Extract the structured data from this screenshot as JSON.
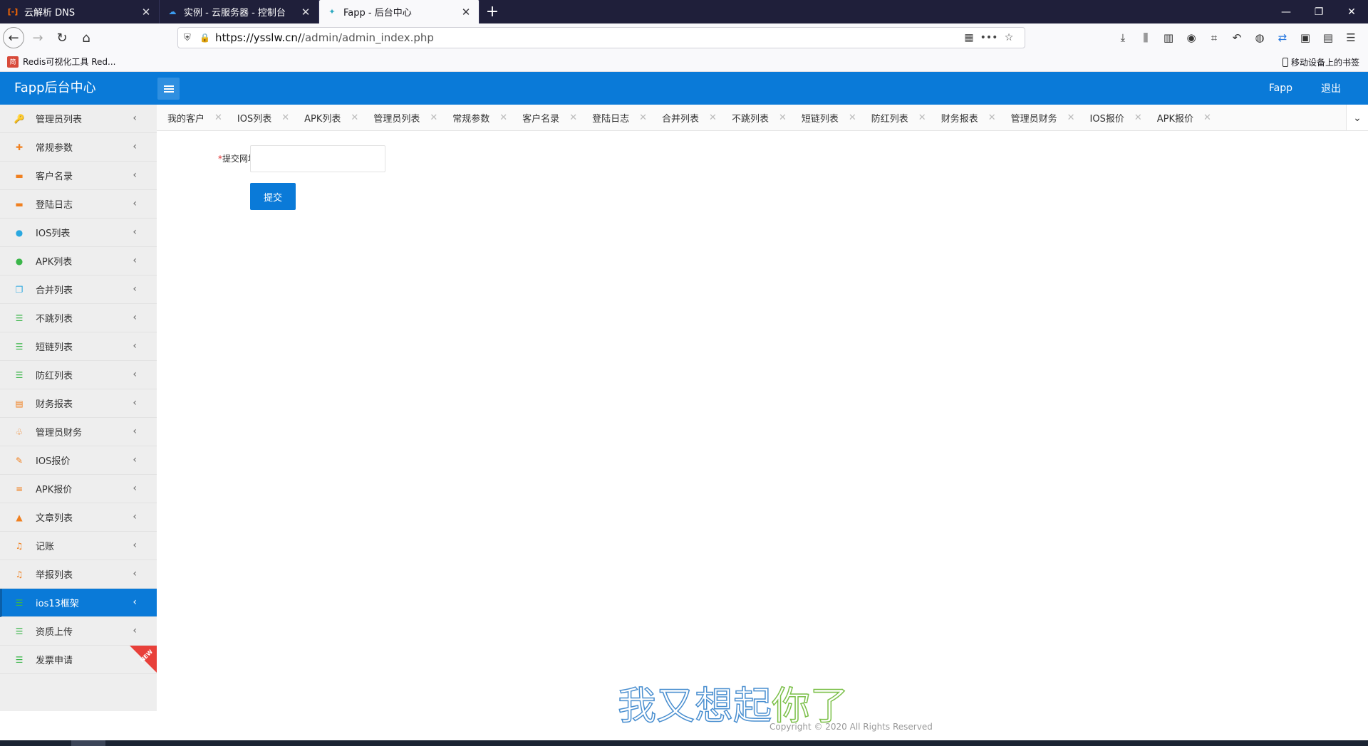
{
  "browser": {
    "tabs": [
      {
        "title": "云解析 DNS",
        "favicon": "aliyun-icon",
        "favicon_glyph": "[-]",
        "active": false
      },
      {
        "title": "实例 - 云服务器 - 控制台",
        "favicon": "cloud-icon",
        "favicon_glyph": "☁",
        "active": false
      },
      {
        "title": "Fapp - 后台中心",
        "favicon": "fapp-icon",
        "favicon_glyph": "✦",
        "active": true
      }
    ],
    "new_tab": "+",
    "url_host": "https://ysslw.cn/",
    "url_path": "/admin/admin_index.php",
    "bookmark": "Redis可视化工具 Red...",
    "bookmark_right": "移动设备上的书签"
  },
  "app": {
    "logo": "Fapp后台中心",
    "header_right": [
      "Fapp",
      "退出"
    ],
    "accent_color": "#0a7ad8"
  },
  "sidebar": {
    "items": [
      {
        "label": "管理员列表",
        "icon": "key-icon",
        "glyph": "🔑",
        "color": "#e8a040"
      },
      {
        "label": "常规参数",
        "icon": "plus-icon",
        "glyph": "✚",
        "color": "#f08020"
      },
      {
        "label": "客户名录",
        "icon": "briefcase-icon",
        "glyph": "▬",
        "color": "#f08020"
      },
      {
        "label": "登陆日志",
        "icon": "briefcase-icon",
        "glyph": "▬",
        "color": "#f08020"
      },
      {
        "label": "IOS列表",
        "icon": "apple-icon",
        "glyph": "●",
        "color": "#2aa8e0"
      },
      {
        "label": "APK列表",
        "icon": "android-icon",
        "glyph": "●",
        "color": "#3bb64a"
      },
      {
        "label": "合并列表",
        "icon": "copy-icon",
        "glyph": "❐",
        "color": "#2aa8e0"
      },
      {
        "label": "不跳列表",
        "icon": "rss-icon",
        "glyph": "☰",
        "color": "#3bb64a"
      },
      {
        "label": "短链列表",
        "icon": "rss-icon",
        "glyph": "☰",
        "color": "#3bb64a"
      },
      {
        "label": "防红列表",
        "icon": "rss-icon",
        "glyph": "☰",
        "color": "#3bb64a"
      },
      {
        "label": "财务报表",
        "icon": "files-icon",
        "glyph": "▤",
        "color": "#f08020"
      },
      {
        "label": "管理员财务",
        "icon": "stethoscope-icon",
        "glyph": "♧",
        "color": "#f08020"
      },
      {
        "label": "IOS报价",
        "icon": "magic-wand-icon",
        "glyph": "✎",
        "color": "#f08020"
      },
      {
        "label": "APK报价",
        "icon": "list-icon",
        "glyph": "≡",
        "color": "#f08020"
      },
      {
        "label": "文章列表",
        "icon": "flask-icon",
        "glyph": "▲",
        "color": "#f08020"
      },
      {
        "label": "记账",
        "icon": "music-icon",
        "glyph": "♫",
        "color": "#f08020"
      },
      {
        "label": "举报列表",
        "icon": "music-icon",
        "glyph": "♫",
        "color": "#f08020"
      },
      {
        "label": "ios13框架",
        "icon": "rss-icon",
        "glyph": "☰",
        "color": "#3bb64a",
        "active": true
      },
      {
        "label": "资质上传",
        "icon": "rss-icon",
        "glyph": "☰",
        "color": "#3bb64a"
      },
      {
        "label": "发票申请",
        "icon": "rss-icon",
        "glyph": "☰",
        "color": "#3bb64a",
        "badge": "NEW"
      }
    ]
  },
  "page_tabs": [
    "我的客户",
    "IOS列表",
    "APK列表",
    "管理员列表",
    "常规参数",
    "客户名录",
    "登陆日志",
    "合并列表",
    "不跳列表",
    "短链列表",
    "防红列表",
    "财务报表",
    "管理员财务",
    "IOS报价",
    "APK报价"
  ],
  "form": {
    "required_mark": "*",
    "label": "提交网址",
    "value": "",
    "submit_label": "提交"
  },
  "footer": {
    "copyright": "Copyright © 2020 All Rights Reserved"
  },
  "watermark": {
    "text_a": "我又想起",
    "text_b": "你了"
  }
}
